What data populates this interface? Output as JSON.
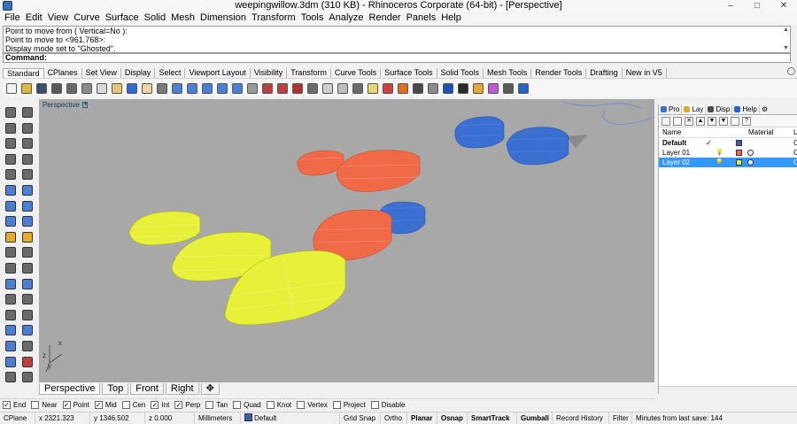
{
  "window": {
    "title": "weepingwillow.3dm (310 KB) - Rhinoceros Corporate (64-bit) - [Perspective]",
    "minimize_icon": "minimize-icon",
    "maximize_icon": "maximize-icon",
    "close_icon": "close-icon"
  },
  "menu": [
    "File",
    "Edit",
    "View",
    "Curve",
    "Surface",
    "Solid",
    "Mesh",
    "Dimension",
    "Transform",
    "Tools",
    "Analyze",
    "Render",
    "Panels",
    "Help"
  ],
  "command_history": [
    "Point to move from ( Vertical=No ):",
    "Point to move to <961.768>:",
    "Display mode set to \"Ghosted\"."
  ],
  "command_prompt": "Command:",
  "toolbar_tabs": [
    "Standard",
    "CPlanes",
    "Set View",
    "Display",
    "Select",
    "Viewport Layout",
    "Visibility",
    "Transform",
    "Curve Tools",
    "Surface Tools",
    "Solid Tools",
    "Mesh Tools",
    "Render Tools",
    "Drafting",
    "New in V5"
  ],
  "standard_tools": [
    {
      "name": "new-icon",
      "color": "#f2f2f2"
    },
    {
      "name": "open-icon",
      "color": "#e2b93f"
    },
    {
      "name": "save-icon",
      "color": "#3a4d6a"
    },
    {
      "name": "print-icon",
      "color": "#5a5a5a"
    },
    {
      "name": "import-icon",
      "color": "#6a6a6a"
    },
    {
      "name": "cut-icon",
      "color": "#8a8a8a"
    },
    {
      "name": "copy-icon",
      "color": "#d9d9d9"
    },
    {
      "name": "paste-icon",
      "color": "#e5c873"
    },
    {
      "name": "undo-icon",
      "color": "#2f6ad0"
    },
    {
      "name": "pan-icon",
      "color": "#f0d2a8"
    },
    {
      "name": "rotate-view-icon",
      "color": "#7a7a7a"
    },
    {
      "name": "zoom-dynamic-icon",
      "color": "#4b7fd1"
    },
    {
      "name": "zoom-window-icon",
      "color": "#4b7fd1"
    },
    {
      "name": "zoom-extents-icon",
      "color": "#4b7fd1"
    },
    {
      "name": "zoom-selected-icon",
      "color": "#4b7fd1"
    },
    {
      "name": "zoom-all-icon",
      "color": "#4b7fd1"
    },
    {
      "name": "named-view-icon",
      "color": "#9a9a9a"
    },
    {
      "name": "four-view-icon",
      "color": "#b84040"
    },
    {
      "name": "grid-icon",
      "color": "#c04040"
    },
    {
      "name": "set-cplane-icon",
      "color": "#b03030"
    },
    {
      "name": "select-icon",
      "color": "#6a6a6a"
    },
    {
      "name": "hide-icon",
      "color": "#cfcfcf"
    },
    {
      "name": "lock-icon",
      "color": "#bdbdbd"
    },
    {
      "name": "show-icon",
      "color": "#6a6a6a"
    },
    {
      "name": "light-icon",
      "color": "#e9d76b"
    },
    {
      "name": "layer-color-icon",
      "color": "#d04040"
    },
    {
      "name": "color-wheel-icon",
      "color": "#e07020"
    },
    {
      "name": "wireframe-icon",
      "color": "#4a4a4a"
    },
    {
      "name": "shaded-icon",
      "color": "#8a8a8a"
    },
    {
      "name": "rendered-icon",
      "color": "#1d4fb6"
    },
    {
      "name": "render-icon",
      "color": "#2a2a2a"
    },
    {
      "name": "osnap-icon",
      "color": "#e6a92a"
    },
    {
      "name": "options-icon",
      "color": "#c05ad0"
    },
    {
      "name": "filter-icon",
      "color": "#5a5a5a"
    },
    {
      "name": "help-icon",
      "color": "#2a60c8"
    }
  ],
  "left_tools": [
    {
      "name": "select-arrow-icon",
      "color": "#6a6a6a"
    },
    {
      "name": "point-icon",
      "color": "#6a6a6a"
    },
    {
      "name": "polyline-icon",
      "color": "#6a6a6a"
    },
    {
      "name": "curve-icon",
      "color": "#6a6a6a"
    },
    {
      "name": "circle-icon",
      "color": "#6a6a6a"
    },
    {
      "name": "arc-icon",
      "color": "#6a6a6a"
    },
    {
      "name": "rectangle-icon",
      "color": "#6a6a6a"
    },
    {
      "name": "polygon-icon",
      "color": "#6a6a6a"
    },
    {
      "name": "ellipse-icon",
      "color": "#6a6a6a"
    },
    {
      "name": "freeform-icon",
      "color": "#6a6a6a"
    },
    {
      "name": "surface-icon",
      "color": "#4b7fd1"
    },
    {
      "name": "extrude-icon",
      "color": "#4b7fd1"
    },
    {
      "name": "box-icon",
      "color": "#4b7fd1"
    },
    {
      "name": "sphere-icon",
      "color": "#4b7fd1"
    },
    {
      "name": "mesh-icon",
      "color": "#4b7fd1"
    },
    {
      "name": "boolean-icon",
      "color": "#4b7fd1"
    },
    {
      "name": "explode-icon",
      "color": "#e6a92a"
    },
    {
      "name": "join-icon",
      "color": "#e6a92a"
    },
    {
      "name": "trim-icon",
      "color": "#6a6a6a"
    },
    {
      "name": "split-icon",
      "color": "#6a6a6a"
    },
    {
      "name": "fillet-icon",
      "color": "#6a6a6a"
    },
    {
      "name": "offset-icon",
      "color": "#6a6a6a"
    },
    {
      "name": "move-icon",
      "color": "#4b7fd1"
    },
    {
      "name": "copy-object-icon",
      "color": "#4b7fd1"
    },
    {
      "name": "rotate-icon",
      "color": "#6a6a6a"
    },
    {
      "name": "scale-icon",
      "color": "#6a6a6a"
    },
    {
      "name": "mirror-icon",
      "color": "#6a6a6a"
    },
    {
      "name": "array-icon",
      "color": "#6a6a6a"
    },
    {
      "name": "dimension-icon",
      "color": "#4b7fd1"
    },
    {
      "name": "text-icon",
      "color": "#4b7fd1"
    },
    {
      "name": "analyze-icon",
      "color": "#4b7fd1"
    },
    {
      "name": "dim-text-icon",
      "color": "#6a6a6a"
    },
    {
      "name": "grid-points-icon",
      "color": "#4b7fd1"
    },
    {
      "name": "blocks-icon",
      "color": "#c04040"
    },
    {
      "name": "drafting-icon",
      "color": "#6a6a6a"
    },
    {
      "name": "more-tools-icon",
      "color": "#6a6a6a"
    }
  ],
  "viewport": {
    "label": "Perspective",
    "background": "#a8a8a8",
    "colors": {
      "yellow": "#e8f03a",
      "orange": "#f06a48",
      "blue": "#3c6fd2"
    },
    "axis_labels": {
      "x": "x",
      "z": "z",
      "y": "y"
    }
  },
  "view_tabs": [
    "Perspective",
    "Top",
    "Front",
    "Right"
  ],
  "add_view_icon": "add-viewport-icon",
  "osnaps": [
    {
      "label": "End",
      "checked": true
    },
    {
      "label": "Near",
      "checked": false
    },
    {
      "label": "Point",
      "checked": true
    },
    {
      "label": "Mid",
      "checked": true
    },
    {
      "label": "Cen",
      "checked": false
    },
    {
      "label": "Int",
      "checked": true
    },
    {
      "label": "Perp",
      "checked": true
    },
    {
      "label": "Tan",
      "checked": false
    },
    {
      "label": "Quad",
      "checked": false
    },
    {
      "label": "Knot",
      "checked": false
    },
    {
      "label": "Vertex",
      "checked": false
    },
    {
      "label": "Project",
      "checked": false
    },
    {
      "label": "Disable",
      "checked": false
    }
  ],
  "status": {
    "cplane": "CPlane",
    "x": "x 2321.323",
    "y": "y 1346.502",
    "z": "z 0.000",
    "units": "Millimeters",
    "layer": "Default",
    "layer_color": "#3b5fa8",
    "grid_snap": "Grid Snap",
    "ortho": "Ortho",
    "planar": "Planar",
    "osnap": "Osnap",
    "smarttrack": "SmartTrack",
    "gumball": "Gumball",
    "record_history": "Record History",
    "filter": "Filter",
    "minutes": "Minutes from last save: 144"
  },
  "panel": {
    "tabs": [
      {
        "label": "Pro",
        "icon": "properties-icon",
        "color": "#3c6fd2"
      },
      {
        "label": "Lay",
        "icon": "layers-icon",
        "color": "#e6a92a"
      },
      {
        "label": "Disp",
        "icon": "display-icon",
        "color": "#4a4a4a"
      },
      {
        "label": "Help",
        "icon": "help-panel-icon",
        "color": "#2a60c8"
      }
    ],
    "toolbar": [
      {
        "name": "new-layer-icon",
        "glyph": ""
      },
      {
        "name": "new-sublayer-icon",
        "glyph": ""
      },
      {
        "name": "delete-layer-icon",
        "glyph": "✕"
      },
      {
        "name": "move-up-icon",
        "glyph": "▲"
      },
      {
        "name": "move-down-icon",
        "glyph": "▼"
      },
      {
        "name": "filter-layers-icon",
        "glyph": "▼"
      },
      {
        "name": "layer-tools-icon",
        "glyph": ""
      },
      {
        "name": "layer-help-icon",
        "glyph": "?"
      }
    ],
    "col_name": "Name",
    "col_material": "Material",
    "col_extra": "L",
    "layers": [
      {
        "name": "Default",
        "current": "✓",
        "color": "#3b5fa8",
        "bold": true,
        "selected": false
      },
      {
        "name": "Layer 01",
        "current": "",
        "color": "#f06a48",
        "bold": false,
        "selected": false
      },
      {
        "name": "Layer 02",
        "current": "",
        "color": "#e8f03a",
        "bold": false,
        "selected": true
      }
    ],
    "layer_suffix": "C"
  }
}
